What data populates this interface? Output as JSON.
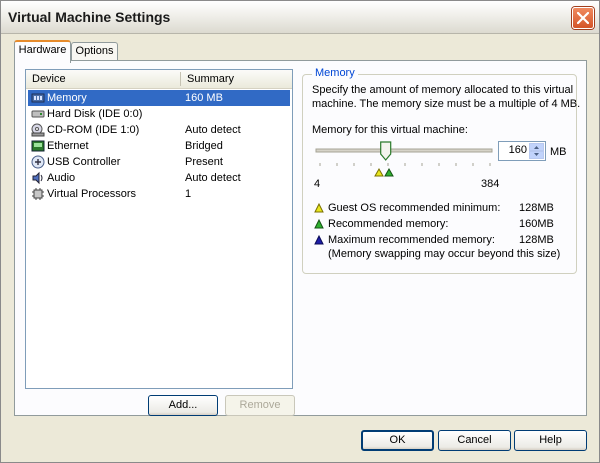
{
  "window": {
    "title": "Virtual Machine Settings"
  },
  "tabs": [
    {
      "label": "Hardware",
      "active": true
    },
    {
      "label": "Options",
      "active": false
    }
  ],
  "device_list": {
    "columns": [
      "Device",
      "Summary"
    ],
    "rows": [
      {
        "icon": "memory-chip-icon",
        "device": "Memory",
        "summary": "160 MB",
        "selected": true
      },
      {
        "icon": "hard-disk-icon",
        "device": "Hard Disk (IDE 0:0)",
        "summary": ""
      },
      {
        "icon": "cdrom-icon",
        "device": "CD-ROM (IDE 1:0)",
        "summary": "Auto detect"
      },
      {
        "icon": "ethernet-icon",
        "device": "Ethernet",
        "summary": "Bridged"
      },
      {
        "icon": "usb-icon",
        "device": "USB Controller",
        "summary": "Present"
      },
      {
        "icon": "audio-speaker-icon",
        "device": "Audio",
        "summary": "Auto detect"
      },
      {
        "icon": "processor-icon",
        "device": "Virtual Processors",
        "summary": "1"
      }
    ]
  },
  "list_buttons": {
    "add": "Add...",
    "remove": "Remove"
  },
  "memory": {
    "group_title": "Memory",
    "description_line1": "Specify the amount of memory allocated to this virtual",
    "description_line2": "machine. The memory size must be a multiple of 4 MB.",
    "slider_label": "Memory for this virtual machine:",
    "value": "160",
    "unit": "MB",
    "min_label": "4",
    "max_label": "384",
    "slider_fraction": 0.41,
    "guest_min_label": "Guest OS recommended minimum:",
    "guest_min_value": "128MB",
    "recommended_label": "Recommended memory:",
    "recommended_value": "160MB",
    "max_rec_label": "Maximum recommended memory:",
    "max_rec_value": "128MB",
    "swap_note": "(Memory swapping may occur beyond this size)",
    "colors": {
      "guest_min": "#e8e61e",
      "recommended": "#2fb12f",
      "max_rec": "#1d1da8"
    }
  },
  "footer_buttons": {
    "ok": "OK",
    "cancel": "Cancel",
    "help": "Help"
  }
}
